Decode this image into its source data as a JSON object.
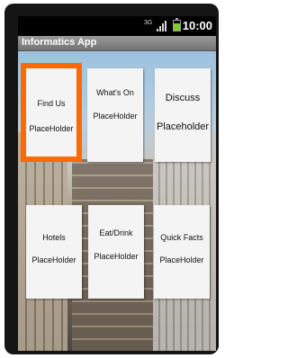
{
  "status_bar": {
    "network": "3G",
    "time": "10:00",
    "icons": [
      "network-3g-icon",
      "signal-icon",
      "battery-icon"
    ]
  },
  "app": {
    "title": "Informatics App"
  },
  "tiles": [
    {
      "label": "Find Us",
      "sub": "PlaceHolder"
    },
    {
      "label": "What's On",
      "sub": "PlaceHolder"
    },
    {
      "label": "Discuss",
      "sub": "Placeholder"
    },
    {
      "label": "Hotels",
      "sub": "PlaceHolder"
    },
    {
      "label": "Eat/Drink",
      "sub": "PlaceHolder"
    },
    {
      "label": "Quick Facts",
      "sub": "PlaceHolder"
    }
  ],
  "colors": {
    "selected_border": "#ff6a00",
    "tile_background": "#f4f4f4",
    "battery": "#7ccf2b"
  }
}
